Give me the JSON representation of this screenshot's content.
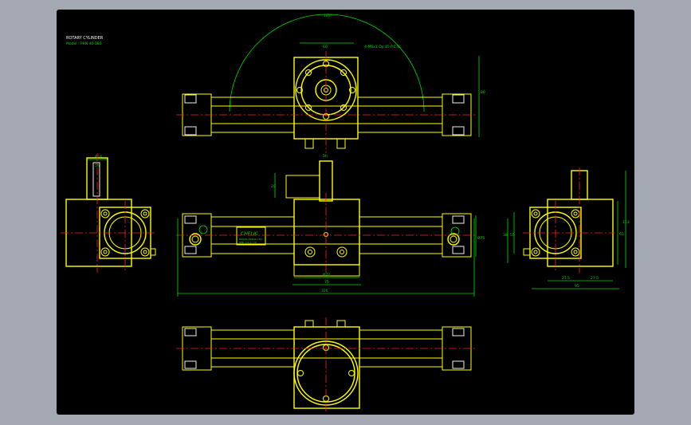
{
  "title_block": {
    "line1": "ROTARY CYLINDER",
    "line2": "Model : PRN 40-180"
  },
  "dimensions": {
    "arc_angle": "180°",
    "top_width": "60",
    "hole_note": "4-M6x1 Dp:15 P.C.D.",
    "top_height": "80",
    "shaft_dia": "Ø16",
    "key_width": "5h",
    "key_height": "20",
    "bottom_a": "Ø72",
    "bottom_b": "75",
    "overall": "326",
    "side_height": "Ø75",
    "right_left_a": "38",
    "right_left_b": "55",
    "right_h1": "65",
    "right_h2": "113",
    "right_w1": "27.5",
    "right_w2": "27.5",
    "right_w3": "95"
  },
  "nameplate": {
    "brand": "CHELIC",
    "line1": "MODEL PRN40-180",
    "line2": "SER. 0.2-0.7 M"
  },
  "colors": {
    "background": "#000000",
    "outline": "#ffff00",
    "center": "#ff2020",
    "dimension": "#00dd00",
    "detail": "#f0f0f0",
    "frame": "#a3a8b2"
  }
}
